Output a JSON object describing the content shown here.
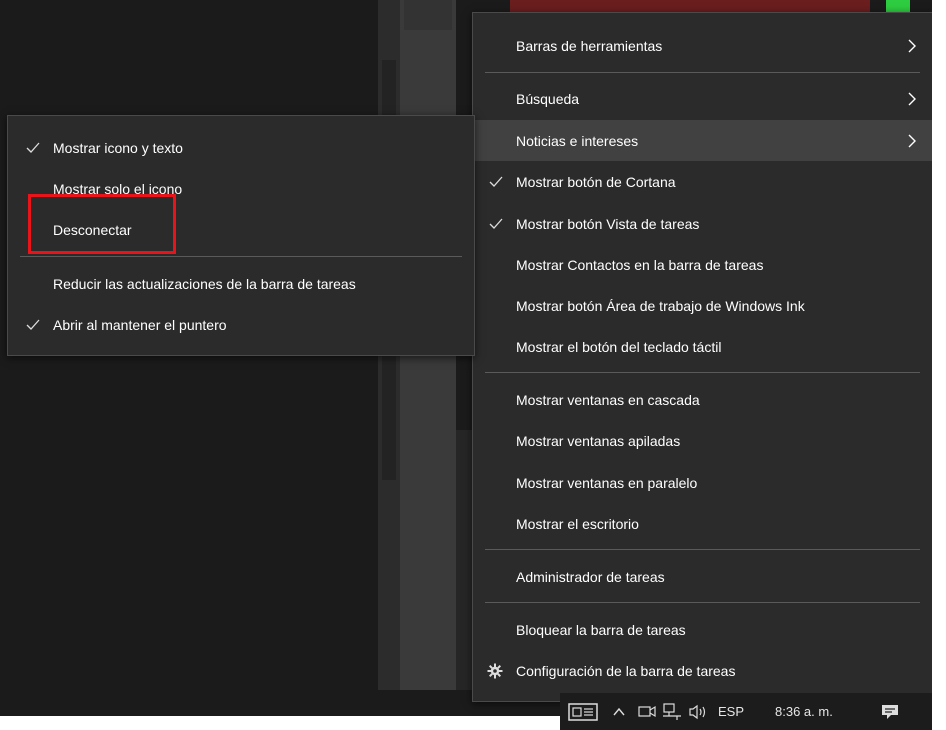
{
  "context_menu": {
    "items": [
      {
        "label": "Barras de herramientas",
        "check": false,
        "submenu": true
      },
      {
        "label": "Búsqueda",
        "check": false,
        "submenu": true
      },
      {
        "label": "Noticias e intereses",
        "check": false,
        "submenu": true,
        "highlighted": true
      },
      {
        "label": "Mostrar botón de Cortana",
        "check": true
      },
      {
        "label": "Mostrar botón Vista de tareas",
        "check": true
      },
      {
        "label": "Mostrar Contactos en la barra de tareas",
        "check": false
      },
      {
        "label": "Mostrar botón Área de trabajo de Windows Ink",
        "check": false
      },
      {
        "label": "Mostrar el botón del teclado táctil",
        "check": false
      },
      {
        "label": "Mostrar ventanas en cascada",
        "check": false
      },
      {
        "label": "Mostrar ventanas apiladas",
        "check": false
      },
      {
        "label": "Mostrar ventanas en paralelo",
        "check": false
      },
      {
        "label": "Mostrar el escritorio",
        "check": false
      },
      {
        "label": "Administrador de tareas",
        "check": false
      },
      {
        "label": "Bloquear la barra de tareas",
        "check": false
      },
      {
        "label": "Configuración de la barra de tareas",
        "check": false,
        "icon": "gear-icon"
      }
    ]
  },
  "submenu": {
    "items": [
      {
        "label": "Mostrar icono y texto",
        "check": true
      },
      {
        "label": "Mostrar solo el icono",
        "check": false
      },
      {
        "label": "Desconectar",
        "check": false,
        "annotated": true
      },
      {
        "label": "Reducir las actualizaciones de la barra de tareas",
        "check": false
      },
      {
        "label": "Abrir al mantener el puntero",
        "check": true
      }
    ]
  },
  "annotation": {
    "color": "#e8141a"
  },
  "tray": {
    "language": "ESP",
    "time": "8:36 a. m.",
    "icons": [
      "news-widget-icon",
      "chevron-up-icon",
      "meet-now-icon",
      "network-icon",
      "volume-icon",
      "notification-icon"
    ]
  },
  "colors": {
    "menu_bg": "#2b2b2b",
    "highlight": "#414141",
    "text": "#ffffff"
  }
}
